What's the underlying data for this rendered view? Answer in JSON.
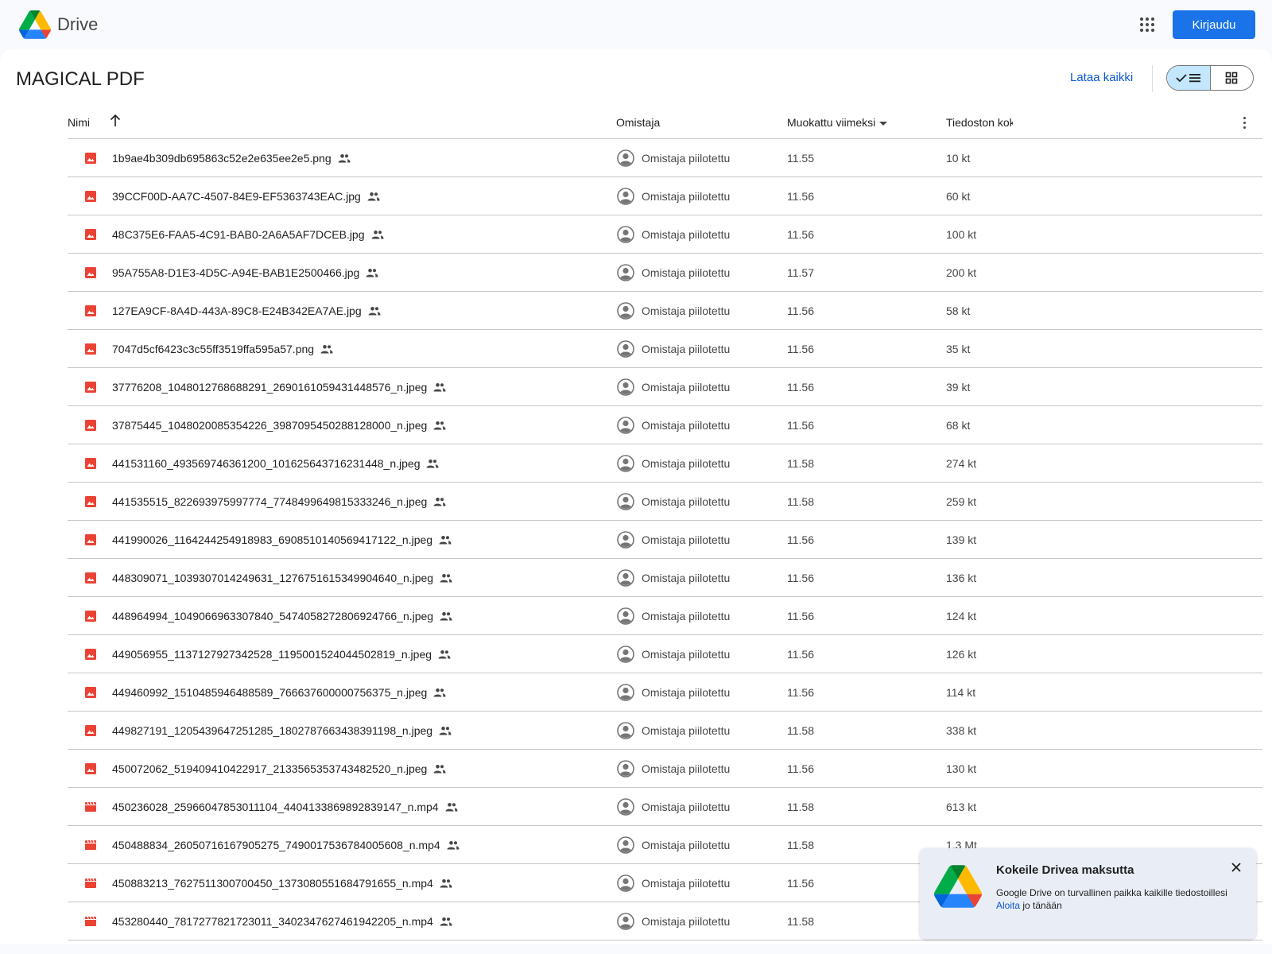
{
  "app": {
    "name": "Drive",
    "signin_label": "Kirjaudu"
  },
  "folder": {
    "title": "MAGICAL PDF",
    "download_all": "Lataa kaikki"
  },
  "columns": {
    "name": "Nimi",
    "owner": "Omistaja",
    "modified": "Muokattu viimeksi",
    "size": "Tiedoston koko"
  },
  "files": [
    {
      "name": "1b9ae4b309db695863c52e2e635ee2e5.png",
      "type": "image",
      "owner": "Omistaja piilotettu",
      "modified": "11.55",
      "size": "10 kt"
    },
    {
      "name": "39CCF00D-AA7C-4507-84E9-EF5363743EAC.jpg",
      "type": "image",
      "owner": "Omistaja piilotettu",
      "modified": "11.56",
      "size": "60 kt"
    },
    {
      "name": "48C375E6-FAA5-4C91-BAB0-2A6A5AF7DCEB.jpg",
      "type": "image",
      "owner": "Omistaja piilotettu",
      "modified": "11.56",
      "size": "100 kt"
    },
    {
      "name": "95A755A8-D1E3-4D5C-A94E-BAB1E2500466.jpg",
      "type": "image",
      "owner": "Omistaja piilotettu",
      "modified": "11.57",
      "size": "200 kt"
    },
    {
      "name": "127EA9CF-8A4D-443A-89C8-E24B342EA7AE.jpg",
      "type": "image",
      "owner": "Omistaja piilotettu",
      "modified": "11.56",
      "size": "58 kt"
    },
    {
      "name": "7047d5cf6423c3c55ff3519ffa595a57.png",
      "type": "image",
      "owner": "Omistaja piilotettu",
      "modified": "11.56",
      "size": "35 kt"
    },
    {
      "name": "37776208_1048012768688291_2690161059431448576_n.jpeg",
      "type": "image",
      "owner": "Omistaja piilotettu",
      "modified": "11.56",
      "size": "39 kt"
    },
    {
      "name": "37875445_1048020085354226_3987095450288128000_n.jpeg",
      "type": "image",
      "owner": "Omistaja piilotettu",
      "modified": "11.56",
      "size": "68 kt"
    },
    {
      "name": "441531160_493569746361200_101625643716231448_n.jpeg",
      "type": "image",
      "owner": "Omistaja piilotettu",
      "modified": "11.58",
      "size": "274 kt"
    },
    {
      "name": "441535515_822693975997774_7748499649815333246_n.jpeg",
      "type": "image",
      "owner": "Omistaja piilotettu",
      "modified": "11.58",
      "size": "259 kt"
    },
    {
      "name": "441990026_1164244254918983_6908510140569417122_n.jpeg",
      "type": "image",
      "owner": "Omistaja piilotettu",
      "modified": "11.56",
      "size": "139 kt"
    },
    {
      "name": "448309071_1039307014249631_1276751615349904640_n.jpeg",
      "type": "image",
      "owner": "Omistaja piilotettu",
      "modified": "11.56",
      "size": "136 kt"
    },
    {
      "name": "448964994_1049066963307840_5474058272806924766_n.jpeg",
      "type": "image",
      "owner": "Omistaja piilotettu",
      "modified": "11.56",
      "size": "124 kt"
    },
    {
      "name": "449056955_1137127927342528_1195001524044502819_n.jpeg",
      "type": "image",
      "owner": "Omistaja piilotettu",
      "modified": "11.56",
      "size": "126 kt"
    },
    {
      "name": "449460992_1510485946488589_766637600000756375_n.jpeg",
      "type": "image",
      "owner": "Omistaja piilotettu",
      "modified": "11.56",
      "size": "114 kt"
    },
    {
      "name": "449827191_1205439647251285_1802787663438391198_n.jpeg",
      "type": "image",
      "owner": "Omistaja piilotettu",
      "modified": "11.58",
      "size": "338 kt"
    },
    {
      "name": "450072062_519409410422917_2133565353743482520_n.jpeg",
      "type": "image",
      "owner": "Omistaja piilotettu",
      "modified": "11.56",
      "size": "130 kt"
    },
    {
      "name": "450236028_25966047853011104_4404133869892839147_n.mp4",
      "type": "video",
      "owner": "Omistaja piilotettu",
      "modified": "11.58",
      "size": "613 kt"
    },
    {
      "name": "450488834_26050716167905275_7490017536784005608_n.mp4",
      "type": "video",
      "owner": "Omistaja piilotettu",
      "modified": "11.58",
      "size": "1,3 Mt"
    },
    {
      "name": "450883213_7627511300700450_1373080551684791655_n.mp4",
      "type": "video",
      "owner": "Omistaja piilotettu",
      "modified": "11.56",
      "size": ""
    },
    {
      "name": "453280440_7817277821723011_3402347627461942205_n.mp4",
      "type": "video",
      "owner": "Omistaja piilotettu",
      "modified": "11.58",
      "size": ""
    }
  ],
  "promo": {
    "title": "Kokeile Drivea maksutta",
    "body": "Google Drive on turvallinen paikka kaikille tiedostoillesi",
    "link": "Aloita",
    "link_suffix": " jo tänään"
  },
  "colors": {
    "accent": "#1a73e8",
    "link": "#0b57d0",
    "image_icon": "#ea4335",
    "video_icon": "#ea4335",
    "toggle_active": "#c2e7ff"
  },
  "icons": {
    "image": "image-file-icon",
    "video": "video-file-icon",
    "shared": "shared-people-icon",
    "owner": "account-circle-icon"
  }
}
